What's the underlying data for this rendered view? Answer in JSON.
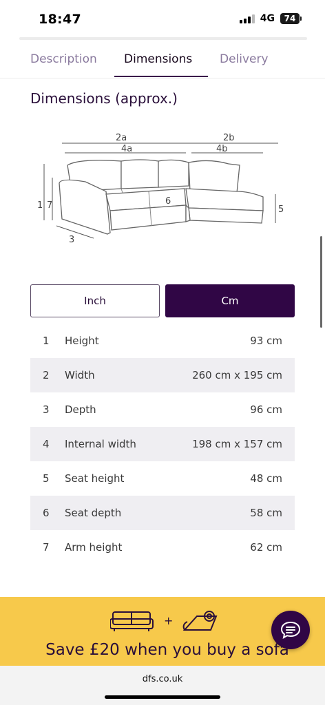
{
  "status": {
    "time": "18:47",
    "network": "4G",
    "battery": "74"
  },
  "tabs": [
    {
      "label": "Description",
      "active": false
    },
    {
      "label": "Dimensions",
      "active": true
    },
    {
      "label": "Delivery",
      "active": false
    }
  ],
  "section_title": "Dimensions (approx.)",
  "diagram": {
    "labels": {
      "top_left_outer": "2a",
      "top_left_inner": "4a",
      "top_right_outer": "2b",
      "top_right_inner": "4b",
      "left_height": "1",
      "left_arm": "7",
      "depth": "3",
      "seat_depth": "6",
      "seat_height": "5"
    }
  },
  "unit_toggle": {
    "inch_label": "Inch",
    "cm_label": "Cm",
    "selected": "Cm"
  },
  "dimensions": [
    {
      "num": "1",
      "label": "Height",
      "value": "93 cm"
    },
    {
      "num": "2",
      "label": "Width",
      "value": "260 cm x 195 cm"
    },
    {
      "num": "3",
      "label": "Depth",
      "value": "96 cm"
    },
    {
      "num": "4",
      "label": "Internal width",
      "value": "198 cm x 157 cm"
    },
    {
      "num": "5",
      "label": "Seat height",
      "value": "48 cm"
    },
    {
      "num": "6",
      "label": "Seat depth",
      "value": "58 cm"
    },
    {
      "num": "7",
      "label": "Arm height",
      "value": "62 cm"
    }
  ],
  "promo": {
    "plus": "+",
    "text": "Save £20 when you buy a sofa"
  },
  "browser": {
    "url": "dfs.co.uk"
  },
  "colors": {
    "brand_purple": "#300645",
    "promo_yellow": "#f7c94b",
    "row_alt": "#efeef2"
  }
}
